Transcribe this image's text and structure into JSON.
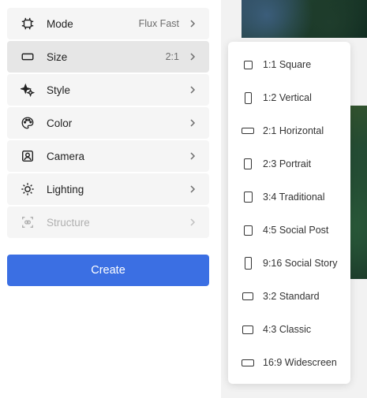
{
  "menu": {
    "items": [
      {
        "label": "Mode",
        "value": "Flux Fast",
        "icon": "chip-icon",
        "active": false,
        "disabled": false
      },
      {
        "label": "Size",
        "value": "2:1",
        "icon": "size-rectangle-icon",
        "active": true,
        "disabled": false
      },
      {
        "label": "Style",
        "value": "",
        "icon": "sparkle-stars-icon",
        "active": false,
        "disabled": false
      },
      {
        "label": "Color",
        "value": "",
        "icon": "palette-icon",
        "active": false,
        "disabled": false
      },
      {
        "label": "Camera",
        "value": "",
        "icon": "camera-icon",
        "active": false,
        "disabled": false
      },
      {
        "label": "Lighting",
        "value": "",
        "icon": "sun-icon",
        "active": false,
        "disabled": false
      },
      {
        "label": "Structure",
        "value": "",
        "icon": "structure-scan-icon",
        "active": false,
        "disabled": true
      }
    ]
  },
  "create": {
    "label": "Create",
    "color": "#3b6fe3"
  },
  "size_dropdown": {
    "options": [
      {
        "label": "1:1 Square"
      },
      {
        "label": "1:2 Vertical"
      },
      {
        "label": "2:1 Horizontal"
      },
      {
        "label": "2:3 Portrait"
      },
      {
        "label": "3:4 Traditional"
      },
      {
        "label": "4:5 Social Post"
      },
      {
        "label": "9:16 Social Story"
      },
      {
        "label": "3:2 Standard"
      },
      {
        "label": "4:3 Classic"
      },
      {
        "label": "16:9 Widescreen"
      }
    ]
  }
}
